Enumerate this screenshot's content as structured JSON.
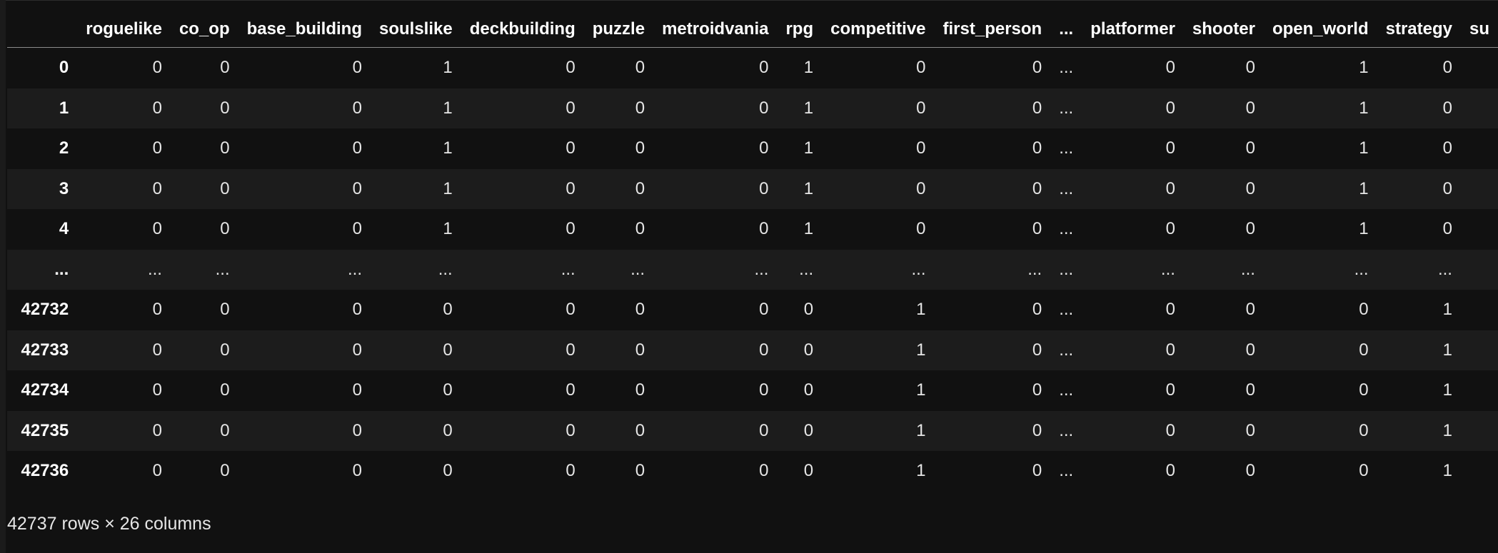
{
  "table": {
    "columns": [
      "roguelike",
      "co_op",
      "base_building",
      "soulslike",
      "deckbuilding",
      "puzzle",
      "metroidvania",
      "rpg",
      "competitive",
      "first_person",
      "...",
      "platformer",
      "shooter",
      "open_world",
      "strategy",
      "su"
    ],
    "rows": [
      {
        "index": "0",
        "cells": [
          "0",
          "0",
          "0",
          "1",
          "0",
          "0",
          "0",
          "1",
          "0",
          "0",
          "...",
          "0",
          "0",
          "1",
          "0",
          ""
        ]
      },
      {
        "index": "1",
        "cells": [
          "0",
          "0",
          "0",
          "1",
          "0",
          "0",
          "0",
          "1",
          "0",
          "0",
          "...",
          "0",
          "0",
          "1",
          "0",
          ""
        ]
      },
      {
        "index": "2",
        "cells": [
          "0",
          "0",
          "0",
          "1",
          "0",
          "0",
          "0",
          "1",
          "0",
          "0",
          "...",
          "0",
          "0",
          "1",
          "0",
          ""
        ]
      },
      {
        "index": "3",
        "cells": [
          "0",
          "0",
          "0",
          "1",
          "0",
          "0",
          "0",
          "1",
          "0",
          "0",
          "...",
          "0",
          "0",
          "1",
          "0",
          ""
        ]
      },
      {
        "index": "4",
        "cells": [
          "0",
          "0",
          "0",
          "1",
          "0",
          "0",
          "0",
          "1",
          "0",
          "0",
          "...",
          "0",
          "0",
          "1",
          "0",
          ""
        ]
      },
      {
        "index": "...",
        "cells": [
          "...",
          "...",
          "...",
          "...",
          "...",
          "...",
          "...",
          "...",
          "...",
          "...",
          "...",
          "...",
          "...",
          "...",
          "...",
          ""
        ]
      },
      {
        "index": "42732",
        "cells": [
          "0",
          "0",
          "0",
          "0",
          "0",
          "0",
          "0",
          "0",
          "1",
          "0",
          "...",
          "0",
          "0",
          "0",
          "1",
          ""
        ]
      },
      {
        "index": "42733",
        "cells": [
          "0",
          "0",
          "0",
          "0",
          "0",
          "0",
          "0",
          "0",
          "1",
          "0",
          "...",
          "0",
          "0",
          "0",
          "1",
          ""
        ]
      },
      {
        "index": "42734",
        "cells": [
          "0",
          "0",
          "0",
          "0",
          "0",
          "0",
          "0",
          "0",
          "1",
          "0",
          "...",
          "0",
          "0",
          "0",
          "1",
          ""
        ]
      },
      {
        "index": "42735",
        "cells": [
          "0",
          "0",
          "0",
          "0",
          "0",
          "0",
          "0",
          "0",
          "1",
          "0",
          "...",
          "0",
          "0",
          "0",
          "1",
          ""
        ]
      },
      {
        "index": "42736",
        "cells": [
          "0",
          "0",
          "0",
          "0",
          "0",
          "0",
          "0",
          "0",
          "1",
          "0",
          "...",
          "0",
          "0",
          "0",
          "1",
          ""
        ]
      }
    ]
  },
  "shape_info": "42737 rows × 26 columns"
}
